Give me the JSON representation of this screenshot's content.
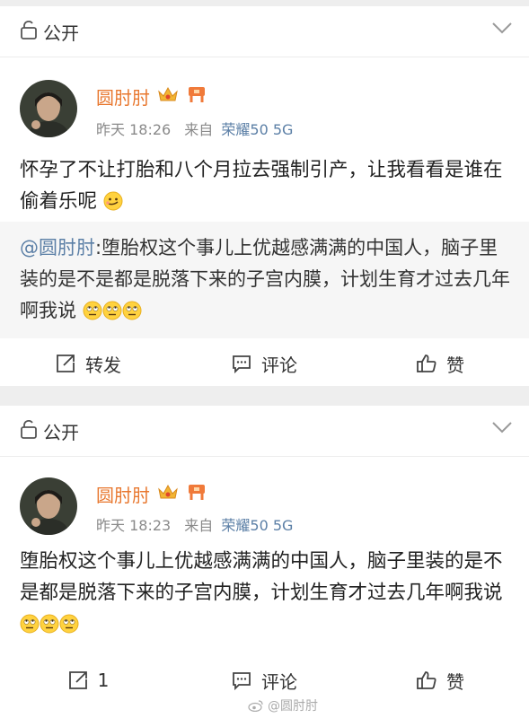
{
  "posts": [
    {
      "visibility": "公开",
      "username": "圆肘肘",
      "time": "昨天 18:26",
      "source_prefix": "来自",
      "source": "荣耀50 5G",
      "text": "怀孕了不让打胎和八个月拉去强制引产，让我看看是谁在偷着乐呢",
      "quote": {
        "mention": "@圆肘肘",
        "text": ":堕胎权这个事儿上优越感满满的中国人，脑子里装的是不是都是脱落下来的子宫内膜，计划生育才过去几年啊我说"
      },
      "actions": {
        "repost": "转发",
        "comment": "评论",
        "like": "赞"
      }
    },
    {
      "visibility": "公开",
      "username": "圆肘肘",
      "time": "昨天 18:23",
      "source_prefix": "来自",
      "source": "荣耀50 5G",
      "text": "堕胎权这个事儿上优越感满满的中国人，脑子里装的是不是都是脱落下来的子宫内膜，计划生育才过去几年啊我说",
      "actions": {
        "repost": "1",
        "comment": "评论",
        "like": "赞"
      }
    }
  ],
  "watermark": "@圆肘肘",
  "icons": {
    "lock": "lock-icon",
    "chevron": "chevron-down-icon",
    "crown": "crown-badge-icon",
    "member": "member-badge-icon",
    "repost": "repost-icon",
    "comment": "comment-icon",
    "like": "thumbs-up-icon",
    "smirk": "smirk-emoji",
    "eyeroll": "eye-roll-emoji"
  },
  "colors": {
    "username": "#e8772e",
    "link": "#5b7fa6",
    "meta": "#8a8a8a",
    "page_bg": "#eeeeee"
  }
}
